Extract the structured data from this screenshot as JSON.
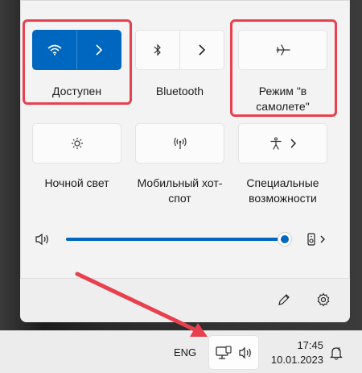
{
  "quick_settings": {
    "wifi": {
      "label": "Доступен",
      "icon": "wifi-icon"
    },
    "bluetooth": {
      "label": "Bluetooth",
      "icon": "bluetooth-icon"
    },
    "airplane": {
      "label": "Режим \"в самолете\"",
      "icon": "airplane-icon"
    },
    "night_light": {
      "label": "Ночной свет",
      "icon": "brightness-icon"
    },
    "hotspot": {
      "label": "Мобильный хот-спот",
      "icon": "hotspot-icon"
    },
    "accessibility": {
      "label": "Специальные возможности",
      "icon": "accessibility-icon"
    }
  },
  "volume": {
    "level": 1.0
  },
  "taskbar": {
    "language": "ENG",
    "time": "17:45",
    "date": "10.01.2023"
  },
  "colors": {
    "accent": "#0067c0",
    "highlight": "#e8404e"
  }
}
